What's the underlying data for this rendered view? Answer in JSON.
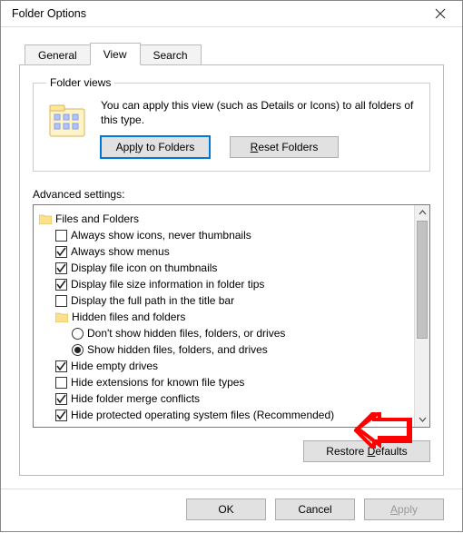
{
  "window": {
    "title": "Folder Options"
  },
  "tabs": {
    "general": "General",
    "view": "View",
    "search": "Search",
    "active": "view"
  },
  "folderViews": {
    "legend": "Folder views",
    "desc": "You can apply this view (such as Details or Icons) to all folders of this type.",
    "applyLabel": "Apply to Folders",
    "resetLabel": "Reset Folders"
  },
  "advancedLabel": "Advanced settings:",
  "tree": {
    "root": "Files and Folders",
    "items": [
      {
        "label": "Always show icons, never thumbnails",
        "checked": false
      },
      {
        "label": "Always show menus",
        "checked": true
      },
      {
        "label": "Display file icon on thumbnails",
        "checked": true
      },
      {
        "label": "Display file size information in folder tips",
        "checked": true
      },
      {
        "label": "Display the full path in the title bar",
        "checked": false
      }
    ],
    "hiddenGroup": {
      "label": "Hidden files and folders",
      "options": [
        {
          "label": "Don't show hidden files, folders, or drives",
          "selected": false
        },
        {
          "label": "Show hidden files, folders, and drives",
          "selected": true
        }
      ]
    },
    "items2": [
      {
        "label": "Hide empty drives",
        "checked": true
      },
      {
        "label": "Hide extensions for known file types",
        "checked": false
      },
      {
        "label": "Hide folder merge conflicts",
        "checked": true
      },
      {
        "label": "Hide protected operating system files (Recommended)",
        "checked": true
      }
    ]
  },
  "restoreLabel": "Restore Defaults",
  "footer": {
    "ok": "OK",
    "cancel": "Cancel",
    "apply": "Apply"
  }
}
